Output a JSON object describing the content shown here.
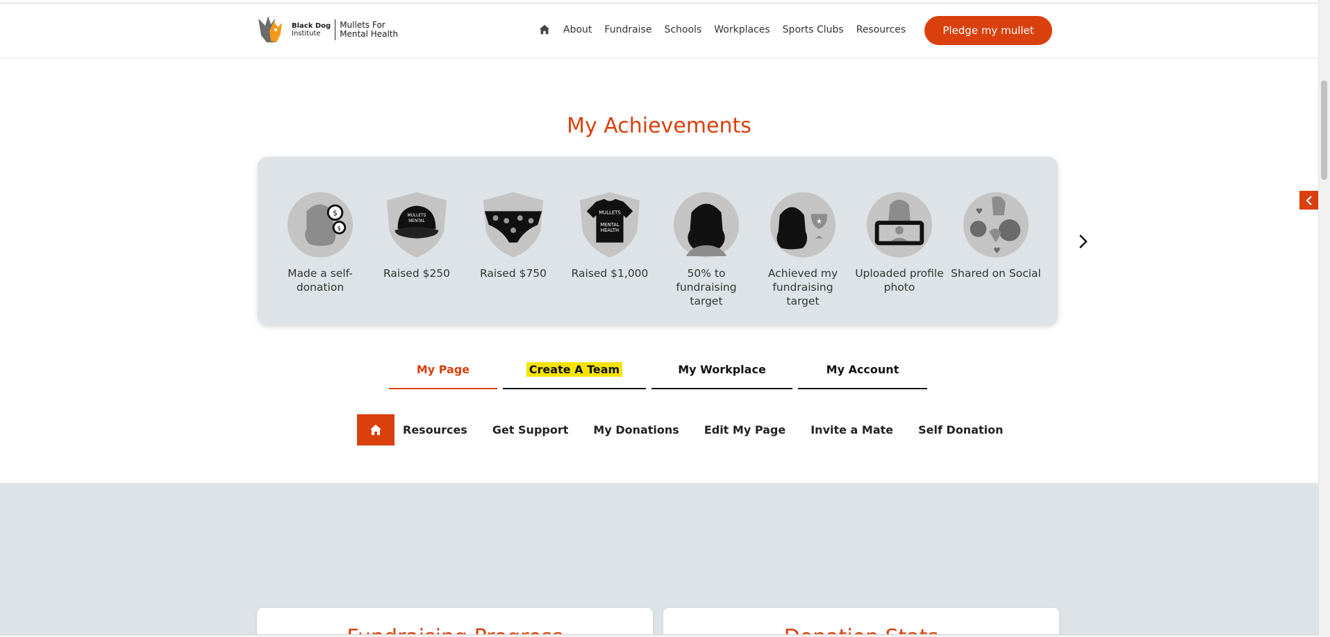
{
  "header": {
    "logo_brand_bold": "Black Dog",
    "logo_brand_sub": "Institute",
    "logo_campaign_line1": "Mullets For",
    "logo_campaign_line2": "Mental Health",
    "nav": [
      "About",
      "Fundraise",
      "Schools",
      "Workplaces",
      "Sports Clubs",
      "Resources"
    ],
    "cta": "Pledge my mullet"
  },
  "achievements": {
    "title": "My Achievements",
    "badges": [
      {
        "label": "Made a self-donation",
        "icon": "mullet-coins-icon"
      },
      {
        "label": "Raised $250",
        "icon": "cap-icon"
      },
      {
        "label": "Raised $750",
        "icon": "undies-icon"
      },
      {
        "label": "Raised $1,000",
        "icon": "tshirt-icon"
      },
      {
        "label": "50% to fundraising target",
        "icon": "mullet-icon"
      },
      {
        "label": "Achieved my fundraising target",
        "icon": "mullet-trophy-icon"
      },
      {
        "label": "Uploaded profile photo",
        "icon": "phone-photo-icon"
      },
      {
        "label": "Shared on Social",
        "icon": "social-hearts-icon"
      }
    ]
  },
  "tabs": [
    "My Page",
    "Create A Team",
    "My Workplace",
    "My Account"
  ],
  "subnav": [
    "Resources",
    "Get Support",
    "My Donations",
    "Edit My Page",
    "Invite a Mate",
    "Self Donation"
  ],
  "cards": [
    "Fundraising Progress",
    "Donation Stats"
  ],
  "colors": {
    "accent": "#d9400e",
    "panel": "#dde3e6",
    "highlight": "#f5e300"
  }
}
